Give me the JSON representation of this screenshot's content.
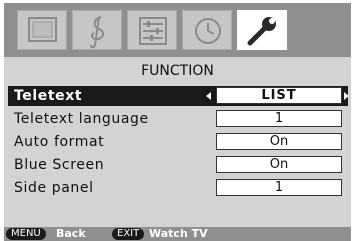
{
  "tabs": [
    {
      "icon": "tv-screen-icon",
      "active": false
    },
    {
      "icon": "music-clef-icon",
      "active": false
    },
    {
      "icon": "equalizer-icon",
      "active": false
    },
    {
      "icon": "clock-icon",
      "active": false
    },
    {
      "icon": "wrench-icon",
      "active": true
    }
  ],
  "menu_title": "FUNCTION",
  "rows": [
    {
      "label": "Teletext",
      "value": "LIST"
    },
    {
      "label": "Teletext language",
      "value": "1"
    },
    {
      "label": "Auto format",
      "value": "On"
    },
    {
      "label": "Blue Screen",
      "value": "On"
    },
    {
      "label": "Side panel",
      "value": "1"
    }
  ],
  "footer": {
    "back_key": "MENU",
    "back_label": "Back",
    "exit_key": "EXIT",
    "exit_label": "Watch TV"
  },
  "colors": {
    "icon_bar": "#8f8f8f",
    "panel": "#d3d3d3",
    "highlight": "#1a1a1a"
  }
}
